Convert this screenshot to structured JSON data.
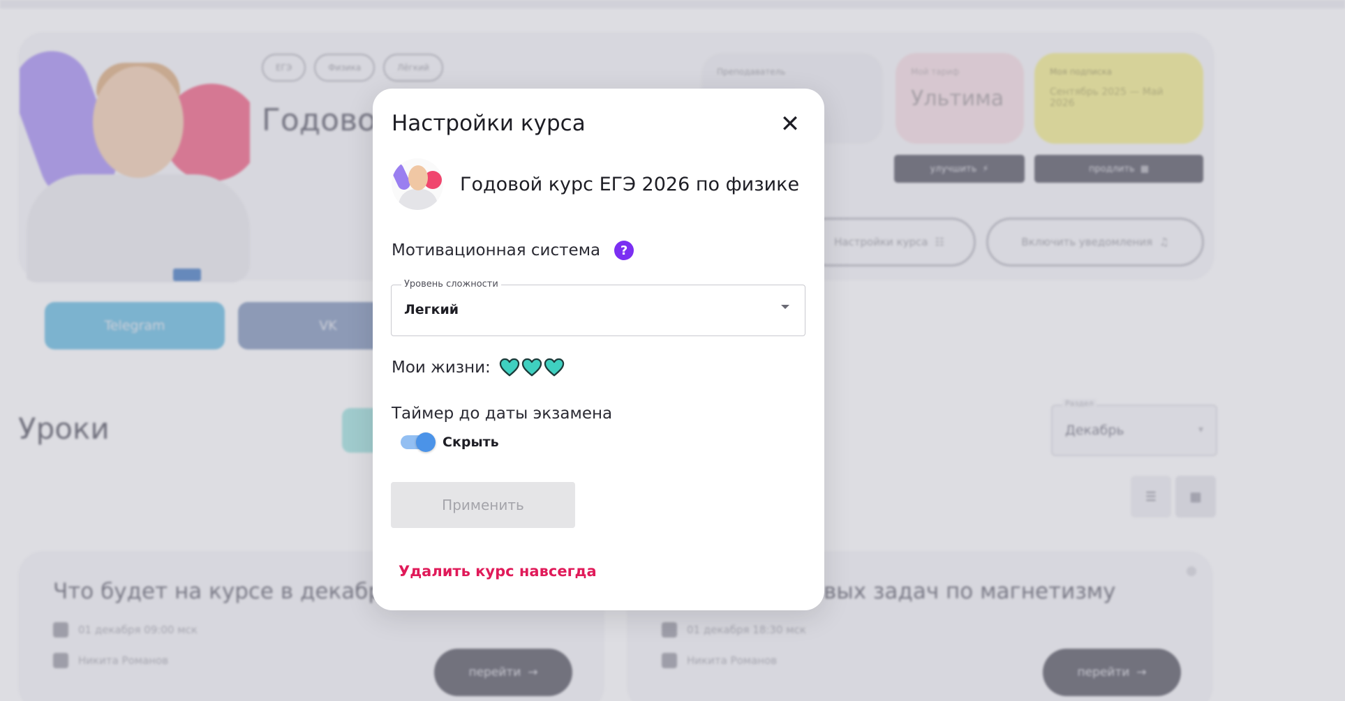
{
  "background": {
    "chips": [
      "ЕГЭ",
      "Физика",
      "Лёгкий"
    ],
    "hero_title": "Годовой курс ЕГЭ 2026 по физике",
    "teacher_label": "Преподаватель",
    "tariff_label": "Мой тариф",
    "tariff_value": "Ультима",
    "subscription_label": "Моя подписка",
    "subscription_value": "Сентябрь 2025 — Май 2026",
    "upgrade_label": "улучшить",
    "extend_label": "продлить",
    "settings_pill": "Настройки курса",
    "notify_pill": "Включить уведомления",
    "telegram": "Telegram",
    "vk": "VK",
    "lessons_title": "Уроки",
    "section_label": "Раздел",
    "section_value": "Декабрь",
    "lessons": [
      {
        "title": "Что будет на курсе в декабре",
        "date": "01 декабря 09:00 мск",
        "teacher": "Никита Романов",
        "go": "перейти"
      },
      {
        "title": "Решение типовых задач по магнетизму",
        "date": "01 декабря 18:30 мск",
        "teacher": "Никита Романов",
        "go": "перейти"
      }
    ]
  },
  "modal": {
    "title": "Настройки курса",
    "course_name": "Годовой курс ЕГЭ 2026 по физике",
    "motivation_label": "Мотивационная система",
    "difficulty_legend": "Уровень сложности",
    "difficulty_value": "Легкий",
    "lives_label": "Мои жизни:",
    "lives_count": 3,
    "heart_color": "#3fd0c0",
    "timer_label": "Таймер до даты экзамена",
    "timer_toggle_text": "Скрыть",
    "timer_toggle_on": true,
    "apply_label": "Применить",
    "delete_label": "Удалить курс навсегда"
  },
  "colors": {
    "accent_purple": "#7b2ff2",
    "toggle_blue": "#4b93e8",
    "danger": "#e01a59"
  }
}
